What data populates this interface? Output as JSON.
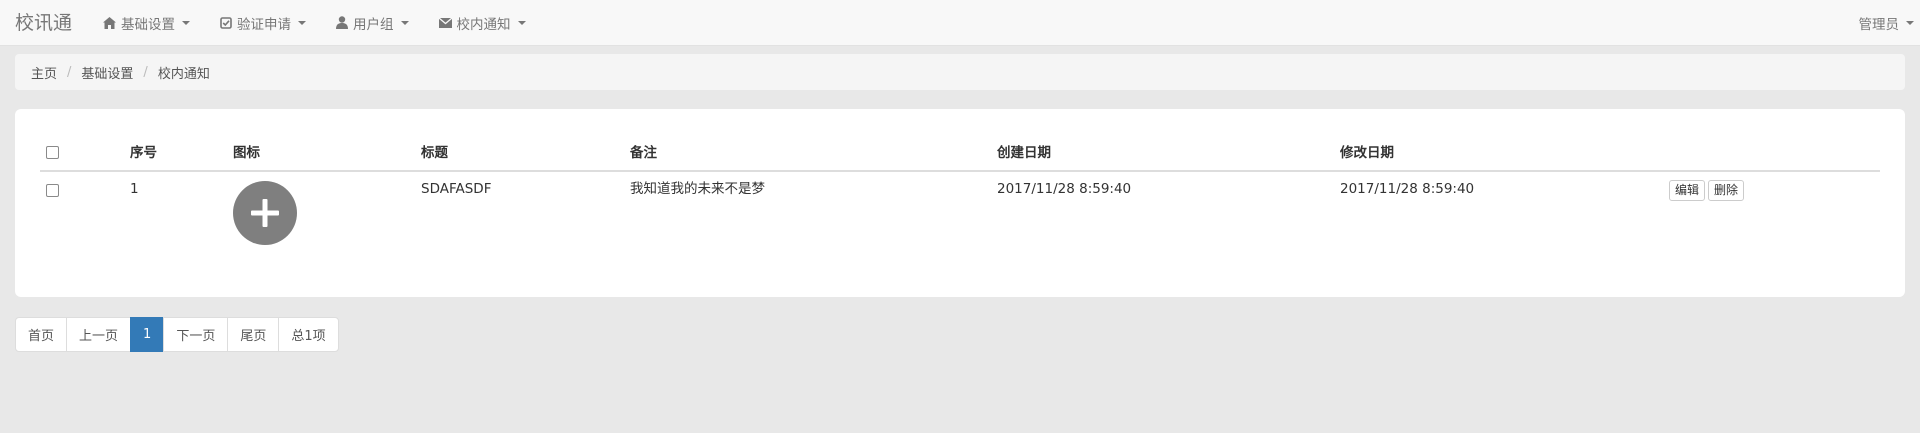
{
  "navbar": {
    "brand": "校讯通",
    "items": [
      {
        "label": "基础设置",
        "icon": "home-icon"
      },
      {
        "label": "验证申请",
        "icon": "check-square-icon"
      },
      {
        "label": "用户组",
        "icon": "user-icon"
      },
      {
        "label": "校内通知",
        "icon": "envelope-icon"
      }
    ],
    "user_menu": "管理员"
  },
  "breadcrumb": {
    "home": "主页",
    "level1": "基础设置",
    "current": "校内通知",
    "separator": "/"
  },
  "table": {
    "headers": {
      "index": "序号",
      "icon": "图标",
      "title": "标题",
      "remark": "备注",
      "created": "创建日期",
      "modified": "修改日期"
    },
    "rows": [
      {
        "index": "1",
        "icon": "plus-circle-icon",
        "title": "SDAFASDF",
        "remark": "我知道我的未来不是梦",
        "created": "2017/11/28 8:59:40",
        "modified": "2017/11/28 8:59:40",
        "edit_label": "编辑",
        "delete_label": "删除"
      }
    ]
  },
  "pagination": {
    "first": "首页",
    "prev": "上一页",
    "current": "1",
    "next": "下一页",
    "last": "尾页",
    "total": "总1项"
  },
  "colors": {
    "accent": "#337ab7",
    "background": "#e8e8e8",
    "navbar": "#f8f8f8",
    "icon_circle": "#7f7f7f"
  }
}
